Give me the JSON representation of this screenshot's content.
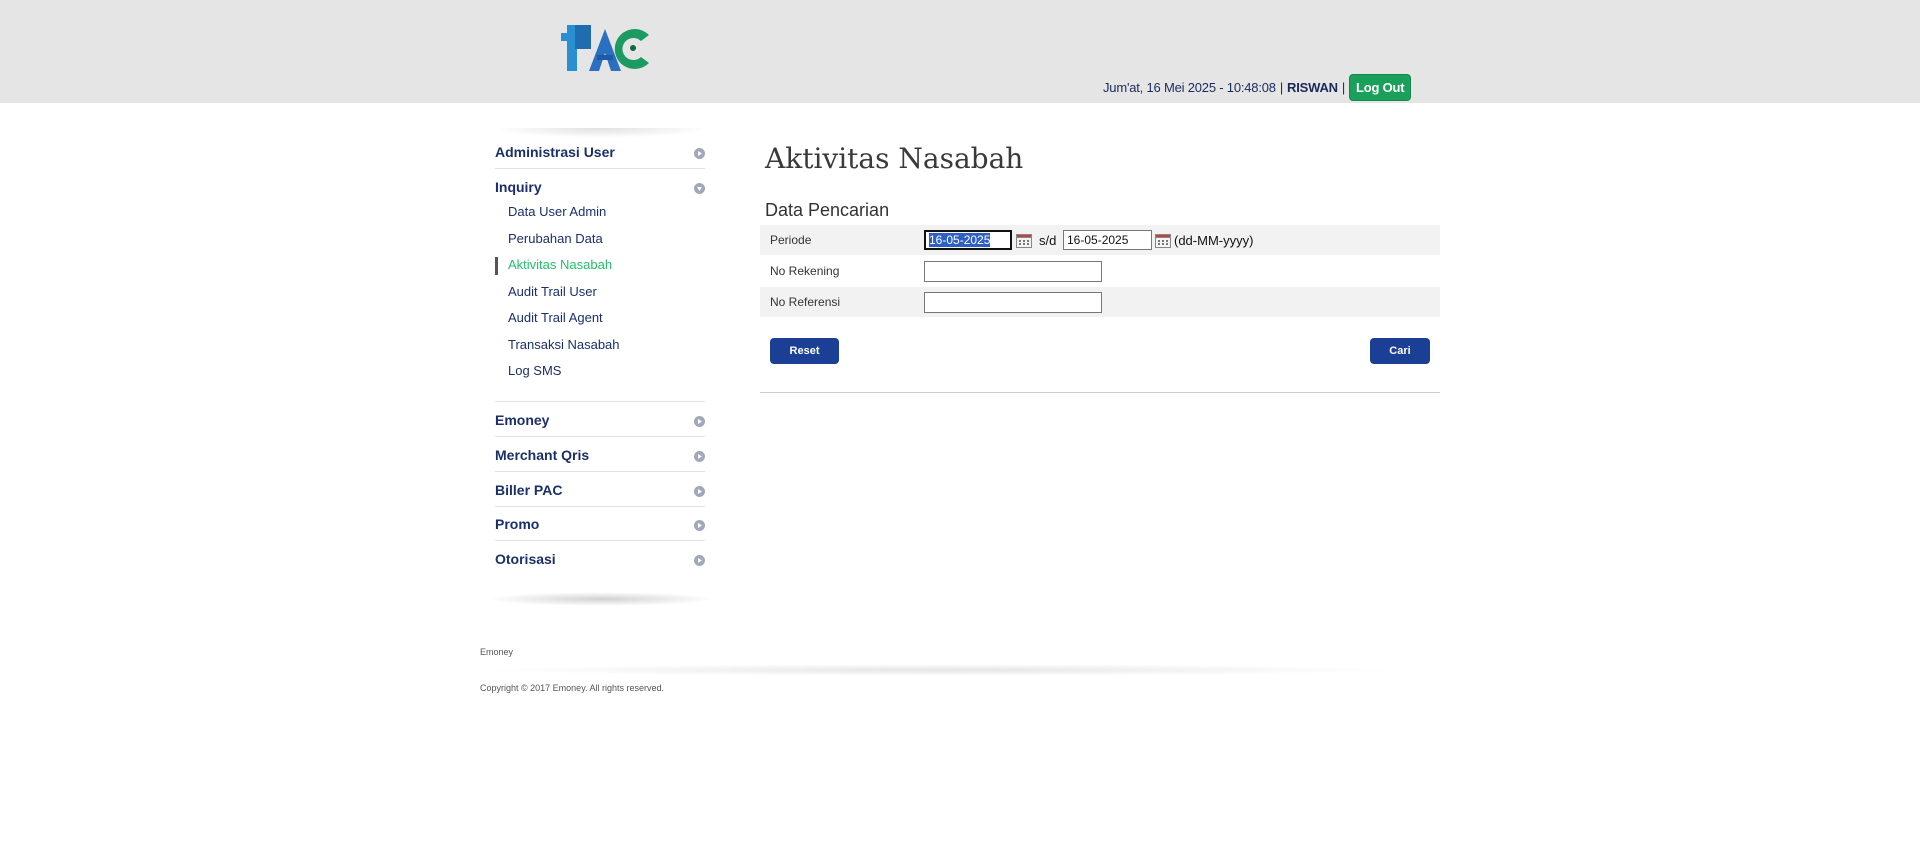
{
  "header": {
    "logo_text": "PAC",
    "datetime": "Jum'at, 16 Mei 2025 - 10:48:08",
    "separator": "|",
    "user": "RISWAN",
    "logout_label": "Log Out"
  },
  "sidebar": {
    "sections": [
      {
        "label": "Administrasi User",
        "expanded": false
      },
      {
        "label": "Inquiry",
        "expanded": true,
        "items": [
          {
            "label": "Data User Admin"
          },
          {
            "label": "Perubahan Data"
          },
          {
            "label": "Aktivitas Nasabah",
            "active": true
          },
          {
            "label": "Audit Trail User"
          },
          {
            "label": "Audit Trail Agent"
          },
          {
            "label": "Transaksi Nasabah"
          },
          {
            "label": "Log SMS"
          }
        ]
      },
      {
        "label": "Emoney",
        "expanded": false
      },
      {
        "label": "Merchant Qris",
        "expanded": false
      },
      {
        "label": "Biller PAC",
        "expanded": false
      },
      {
        "label": "Promo",
        "expanded": false
      },
      {
        "label": "Otorisasi",
        "expanded": false
      }
    ]
  },
  "main": {
    "title": "Aktivitas Nasabah",
    "section_title": "Data Pencarian",
    "form": {
      "periode_label": "Periode",
      "date_from": "16-05-2025",
      "sd_label": "s/d",
      "date_to": "16-05-2025",
      "date_format_hint": "(dd-MM-yyyy)",
      "no_rekening_label": "No Rekening",
      "no_rekening_value": "",
      "no_referensi_label": "No Referensi",
      "no_referensi_value": ""
    },
    "reset_label": "Reset",
    "search_label": "Cari"
  },
  "footer": {
    "brand": "Emoney",
    "copyright": "Copyright © 2017 Emoney. All rights reserved."
  },
  "colors": {
    "header_bg": "#e6e5e6",
    "logout_green": "#1aa05a",
    "nav_blue": "#1b2f6b",
    "active_green": "#22c06a",
    "button_blue": "#1a3f95"
  }
}
